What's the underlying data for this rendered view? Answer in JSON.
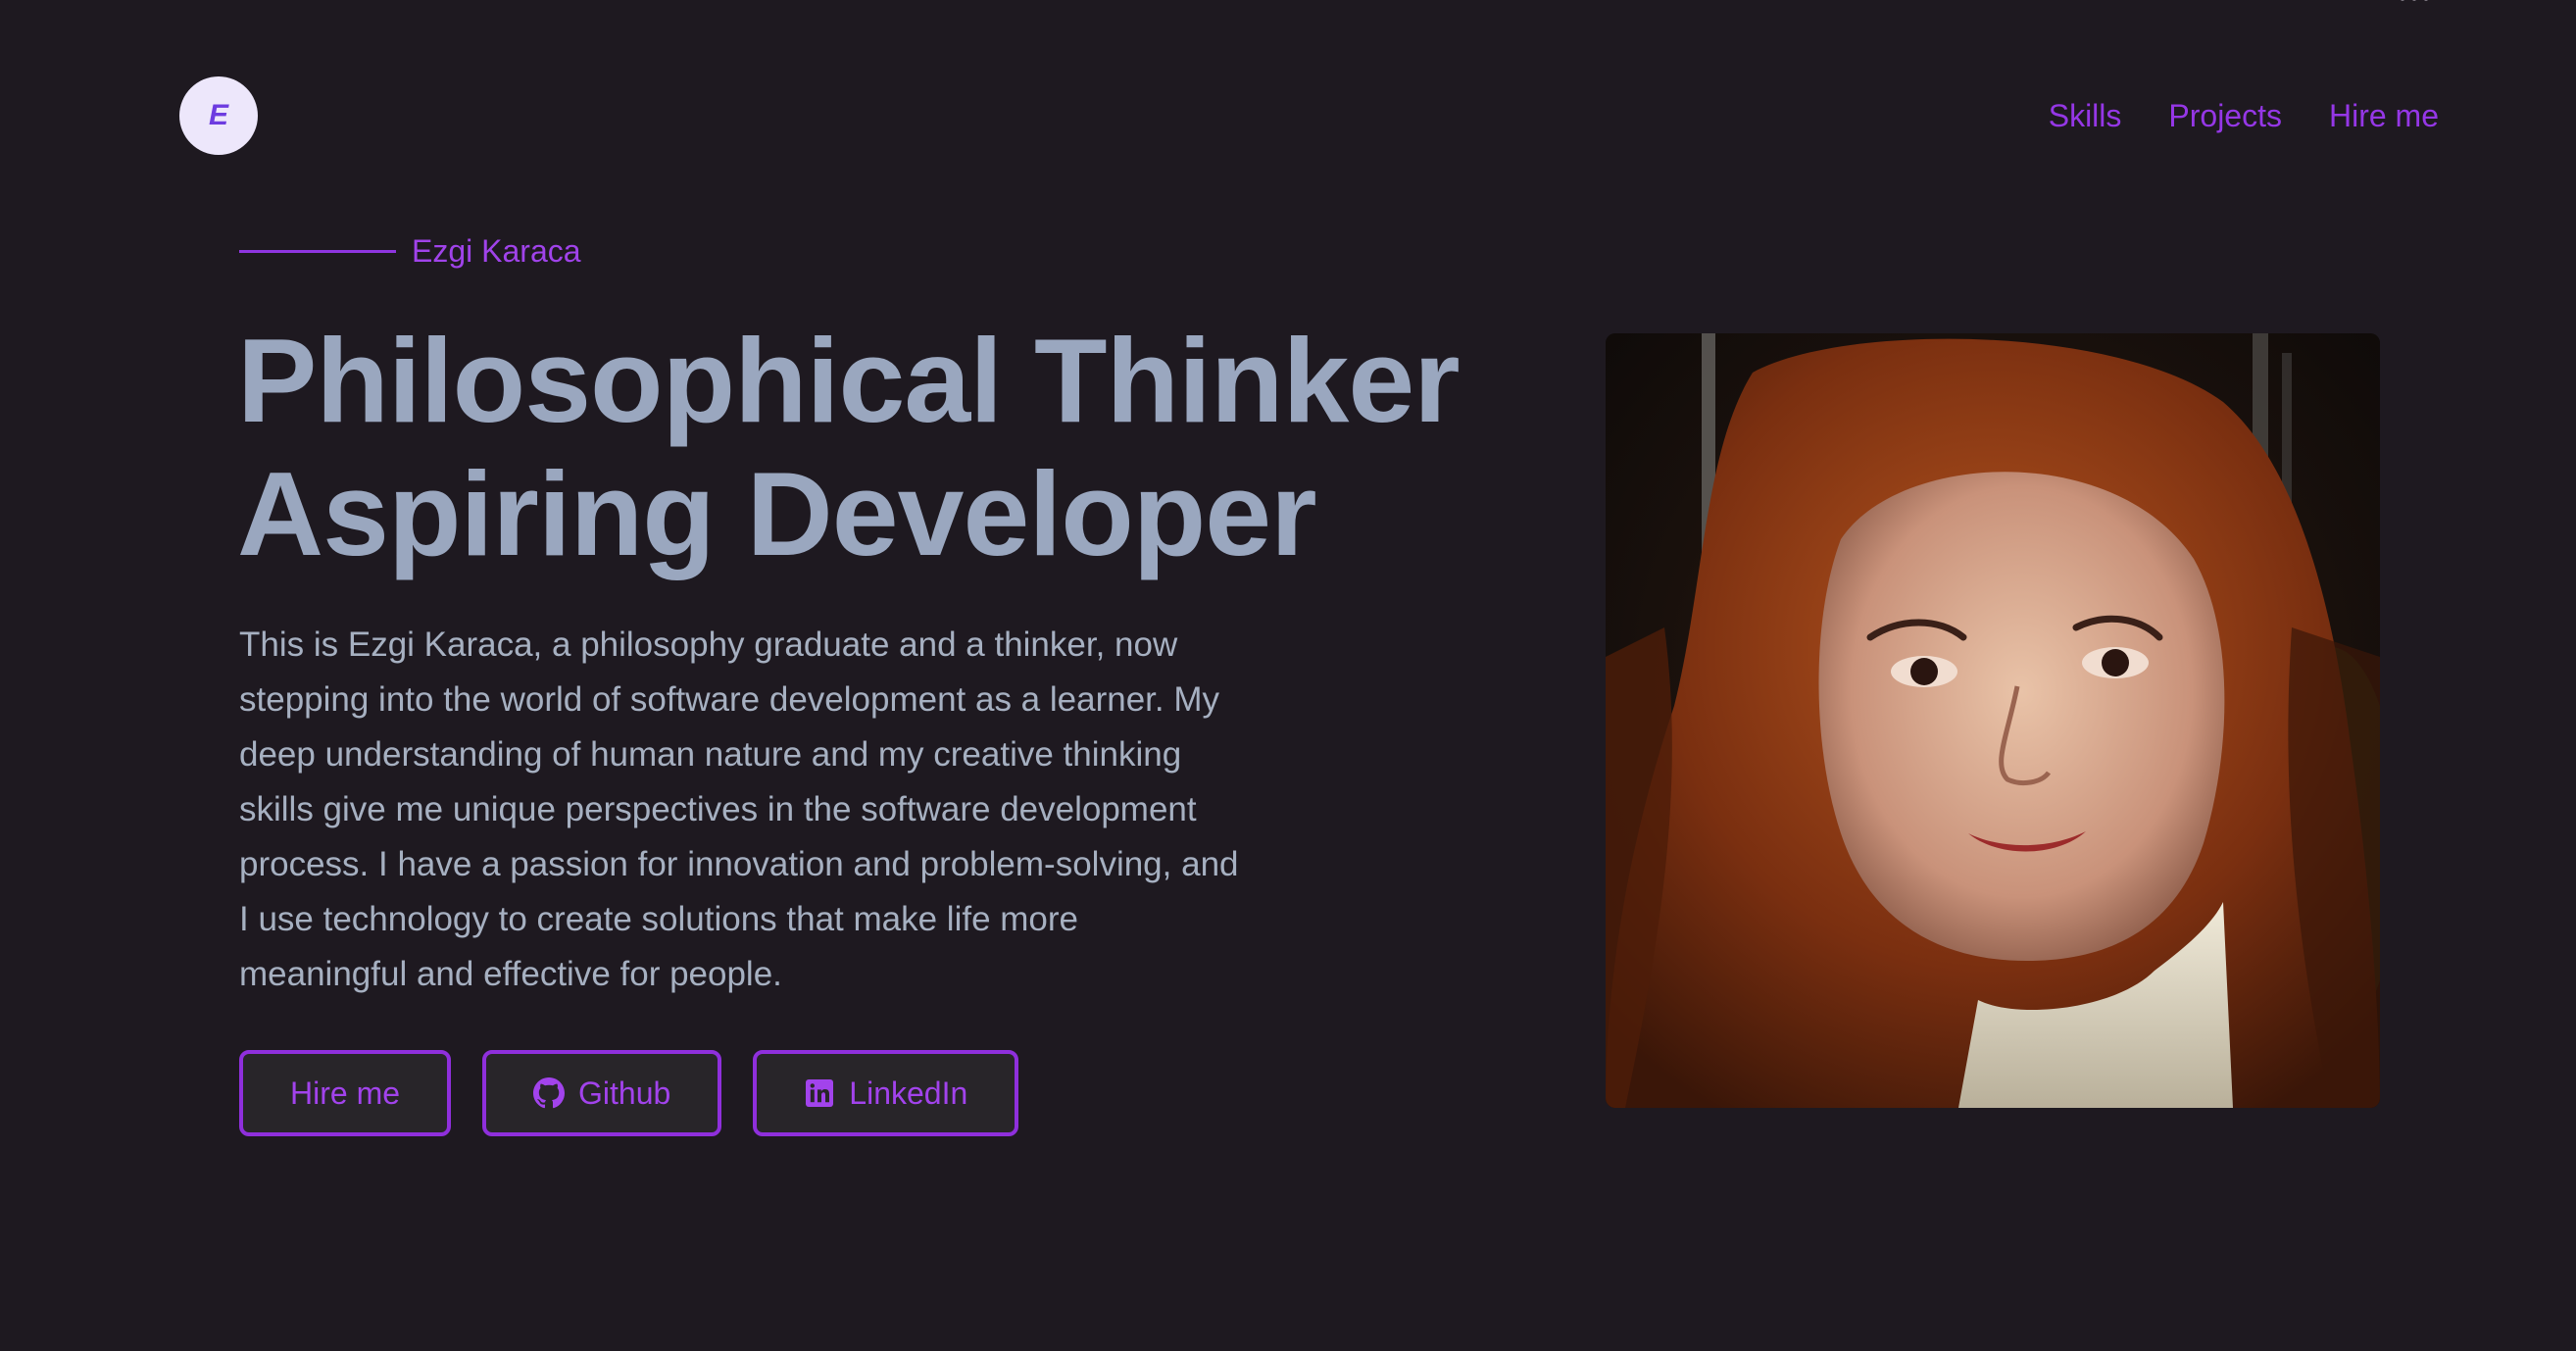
{
  "header": {
    "logo_letter": "E",
    "nav": [
      {
        "label": "Skills"
      },
      {
        "label": "Projects"
      },
      {
        "label": "Hire me"
      }
    ]
  },
  "hero": {
    "eyebrow": "Ezgi Karaca",
    "headline_line1": "Philosophical Thinker",
    "headline_line2": "Aspiring Developer",
    "bio": "This is Ezgi Karaca, a philosophy graduate and a thinker, now stepping into the world of software development as a learner. My deep understanding of human nature and my creative thinking skills give me unique perspectives in the software development process. I have a passion for innovation and problem-solving, and I use technology to create solutions that make life more meaningful and effective for people.",
    "buttons": {
      "hire": "Hire me",
      "github": "Github",
      "linkedin": "LinkedIn"
    },
    "icons": {
      "github": "github-icon",
      "linkedin": "linkedin-icon"
    }
  },
  "colors": {
    "background": "#1e1920",
    "accent": "#9537e6",
    "headline": "#9aa7bf",
    "body_text": "#a6b0c1",
    "logo_bg": "#ede7fb"
  },
  "photo": {
    "subject": "portrait-photo"
  }
}
